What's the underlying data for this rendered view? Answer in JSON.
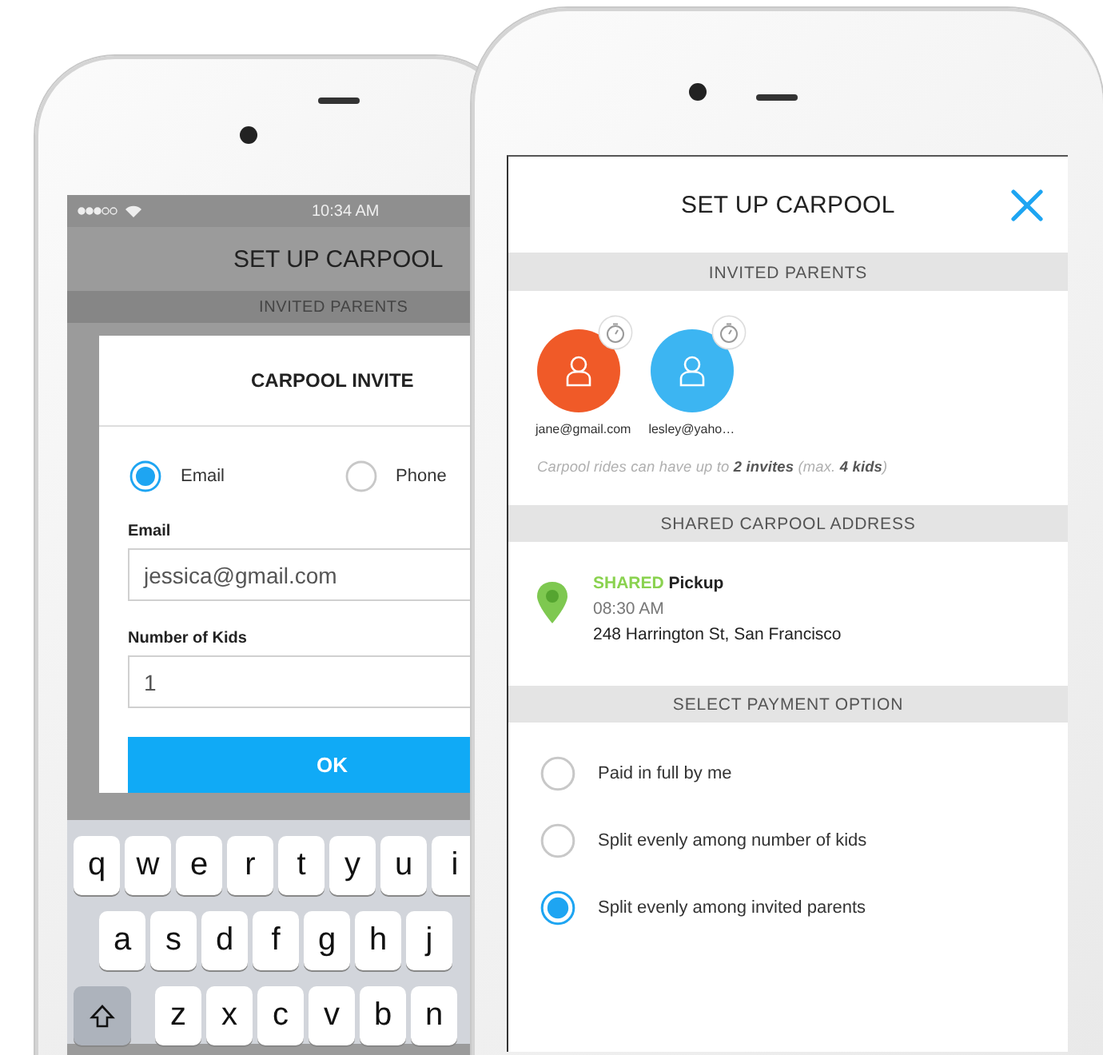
{
  "back_phone": {
    "status_bar": {
      "time": "10:34 AM"
    },
    "title": "SET UP CARPOOL",
    "section": "INVITED PARENTS",
    "dialog": {
      "title": "CARPOOL INVITE",
      "contact_options": [
        {
          "label": "Email",
          "selected": true
        },
        {
          "label": "Phone",
          "selected": false
        }
      ],
      "fields": [
        {
          "label": "Email",
          "value": "jessica@gmail.com"
        },
        {
          "label": "Number of Kids",
          "value": "1"
        }
      ],
      "button": "OK"
    },
    "keyboard": {
      "rows": [
        [
          "q",
          "w",
          "e",
          "r",
          "t",
          "y",
          "u",
          "i"
        ],
        [
          "a",
          "s",
          "d",
          "f",
          "g",
          "h",
          "j"
        ],
        [
          "z",
          "x",
          "c",
          "v",
          "b",
          "n"
        ]
      ]
    }
  },
  "front_phone": {
    "title": "SET UP CARPOOL",
    "invited_parents": {
      "heading": "INVITED PARENTS",
      "parents": [
        {
          "email": "jane@gmail.com",
          "color": "#f05a28"
        },
        {
          "email": "lesley@yaho…",
          "color": "#3cb5f2"
        }
      ],
      "note": "Carpool rides can have up to **2 invites** (max. **4 kids**)"
    },
    "address": {
      "heading": "SHARED CARPOOL ADDRESS",
      "tag": "SHARED",
      "label": "Pickup",
      "time": "08:30 AM",
      "street": "248 Harrington St, San Francisco"
    },
    "payment": {
      "heading": "SELECT PAYMENT OPTION",
      "options": [
        {
          "label": "Paid in full by me",
          "selected": false
        },
        {
          "label": "Split evenly among number of kids",
          "selected": false
        },
        {
          "label": "Split evenly among invited parents",
          "selected": true
        }
      ]
    }
  }
}
